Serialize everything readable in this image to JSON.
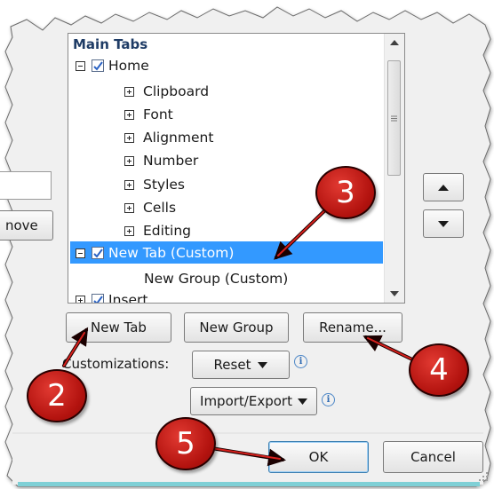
{
  "tree": {
    "header": "Main Tabs",
    "items": [
      {
        "label": "Home",
        "expander": "minus",
        "checked": true
      },
      {
        "label": "Clipboard",
        "expander": "plus"
      },
      {
        "label": "Font",
        "expander": "plus"
      },
      {
        "label": "Alignment",
        "expander": "plus"
      },
      {
        "label": "Number",
        "expander": "plus"
      },
      {
        "label": "Styles",
        "expander": "plus"
      },
      {
        "label": "Cells",
        "expander": "plus"
      },
      {
        "label": "Editing",
        "expander": "plus"
      },
      {
        "label": "New Tab (Custom)",
        "expander": "minus",
        "checked": true,
        "selected": true
      },
      {
        "label": "New Group (Custom)"
      },
      {
        "label": "Insert",
        "expander": "plus",
        "checked": true
      }
    ]
  },
  "left_partial": {
    "remove_label": "nove"
  },
  "buttons": {
    "new_tab": "New Tab",
    "new_tab_ul": "w",
    "new_group": "New Group",
    "rename": "Rename...",
    "reset": "Reset",
    "import_export": "Import/Export",
    "ok": "OK",
    "cancel": "Cancel"
  },
  "labels": {
    "customizations": "Customizations:"
  },
  "callouts": [
    "2",
    "3",
    "4",
    "5"
  ],
  "colors": {
    "selection": "#3399ff",
    "callout_red": "#c8171a",
    "dialog_bg": "#f0f0f0",
    "footer_bg": "#f0f0f0",
    "checkbox_blue": "#2b63c4"
  },
  "icons": {
    "scroll_up": "triangle-up-icon",
    "scroll_down": "triangle-down-icon",
    "move_up": "triangle-up-icon",
    "move_down": "triangle-down-icon",
    "info": "info-icon",
    "dropdown": "triangle-down-icon"
  }
}
